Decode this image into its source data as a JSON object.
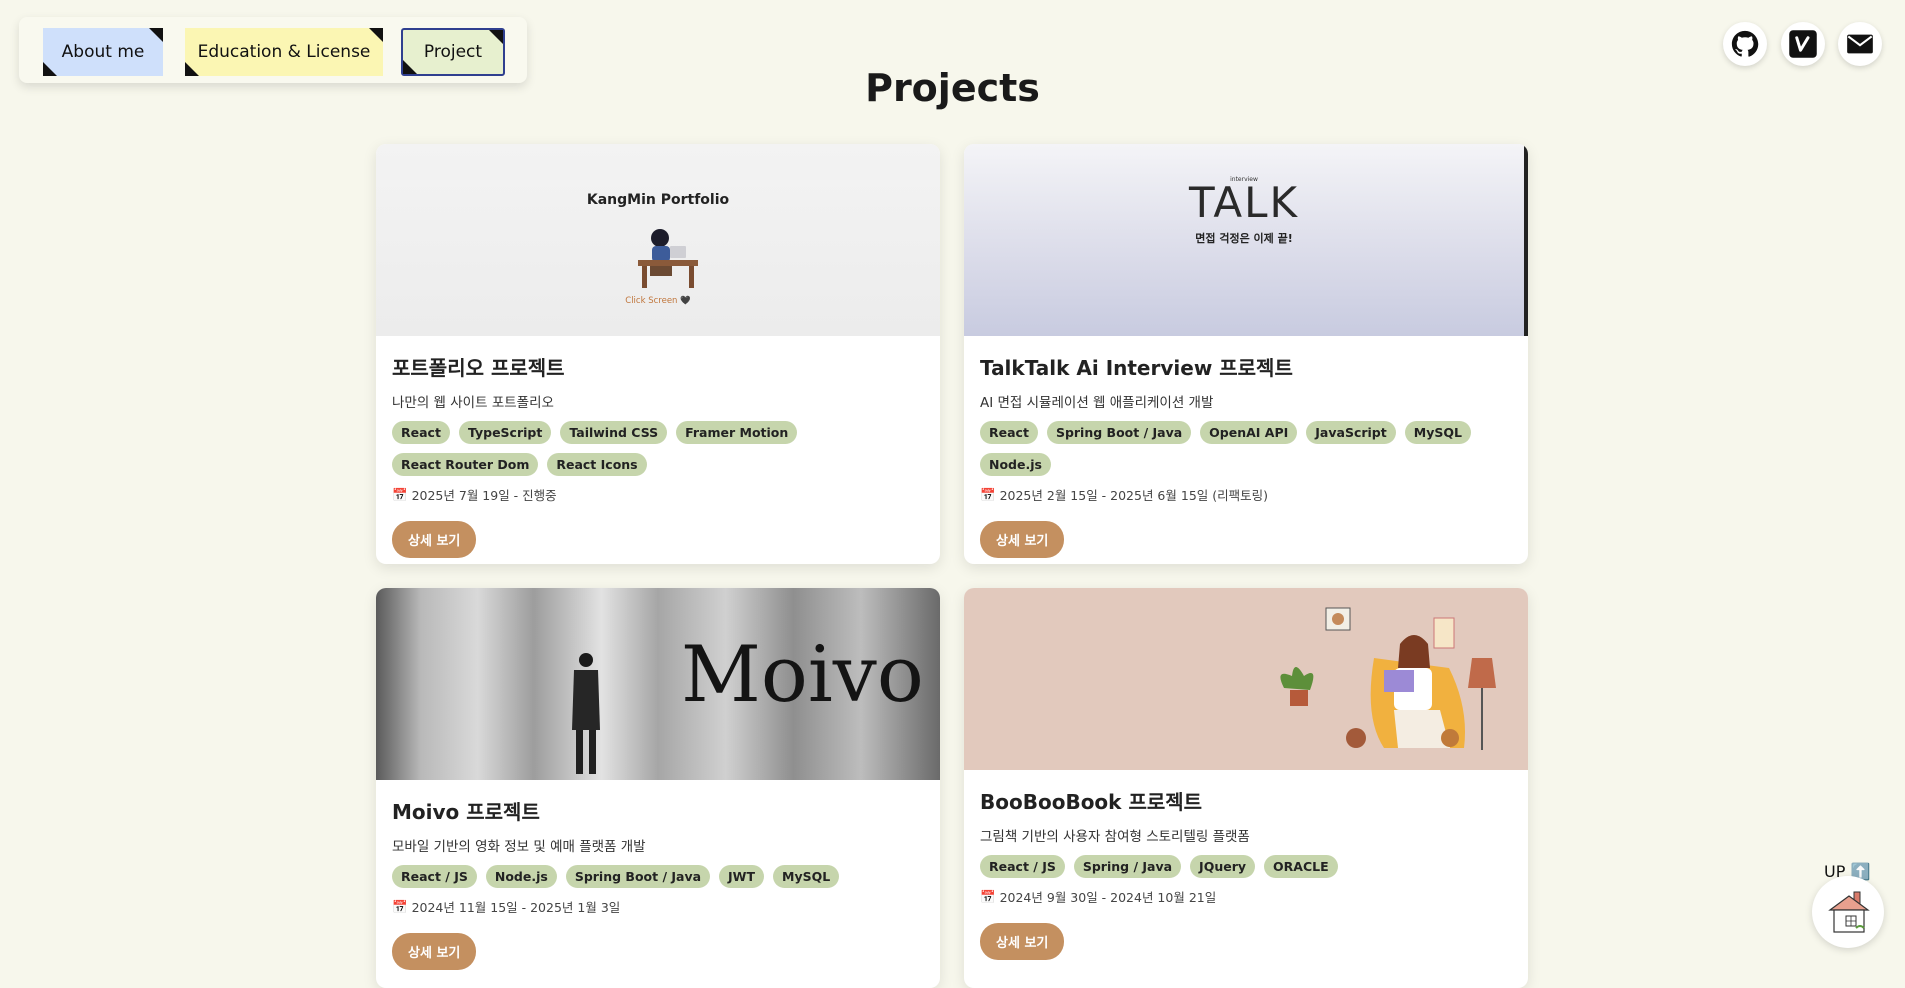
{
  "nav": {
    "tabs": [
      {
        "label": "About me"
      },
      {
        "label": "Education & License"
      },
      {
        "label": "Project"
      }
    ]
  },
  "page": {
    "title": "Projects"
  },
  "social": [
    "github-icon",
    "velog-icon",
    "mail-icon"
  ],
  "projects": [
    {
      "thumb_title": "KangMin Portfolio",
      "thumb_caption": "Click Screen 🖤",
      "title": "포트폴리오 프로젝트",
      "desc": "나만의 웹 사이트 포트폴리오",
      "tags": [
        "React",
        "TypeScript",
        "Tailwind CSS",
        "Framer Motion",
        "React Router Dom",
        "React Icons"
      ],
      "date": "2025년 7월 19일 - 진행중",
      "button": "상세 보기"
    },
    {
      "thumb_small": "interview",
      "thumb_title": "TALK",
      "thumb_caption": "면접 걱정은 이제 끝!",
      "title": "TalkTalk Ai Interview 프로젝트",
      "desc": "AI 면접 시뮬레이션 웹 애플리케이션 개발",
      "tags": [
        "React",
        "Spring Boot / Java",
        "OpenAI API",
        "JavaScript",
        "MySQL",
        "Node.js"
      ],
      "date": "2025년 2월 15일 - 2025년 6월 15일 (리팩토링)",
      "button": "상세 보기"
    },
    {
      "thumb_title": "Moivo",
      "title": "Moivo 프로젝트",
      "desc": "모바일 기반의 영화 정보 및 예매 플랫폼 개발",
      "tags": [
        "React / JS",
        "Node.js",
        "Spring Boot / Java",
        "JWT",
        "MySQL"
      ],
      "date": "2024년 11월 15일 - 2025년 1월 3일",
      "button": "상세 보기"
    },
    {
      "title": "BooBooBook 프로젝트",
      "desc": "그림책 기반의 사용자 참여형 스토리텔링 플랫폼",
      "tags": [
        "React / JS",
        "Spring / Java",
        "JQuery",
        "ORACLE"
      ],
      "date": "2024년 9월 30일 - 2024년 10월 21일",
      "button": "상세 보기"
    }
  ],
  "up": {
    "label": "UP ⬆️"
  },
  "colors": {
    "background": "#f7f7ec",
    "tag": "#c6d5ac",
    "button": "#c49060",
    "active_tab_border": "#2f3f8f"
  }
}
